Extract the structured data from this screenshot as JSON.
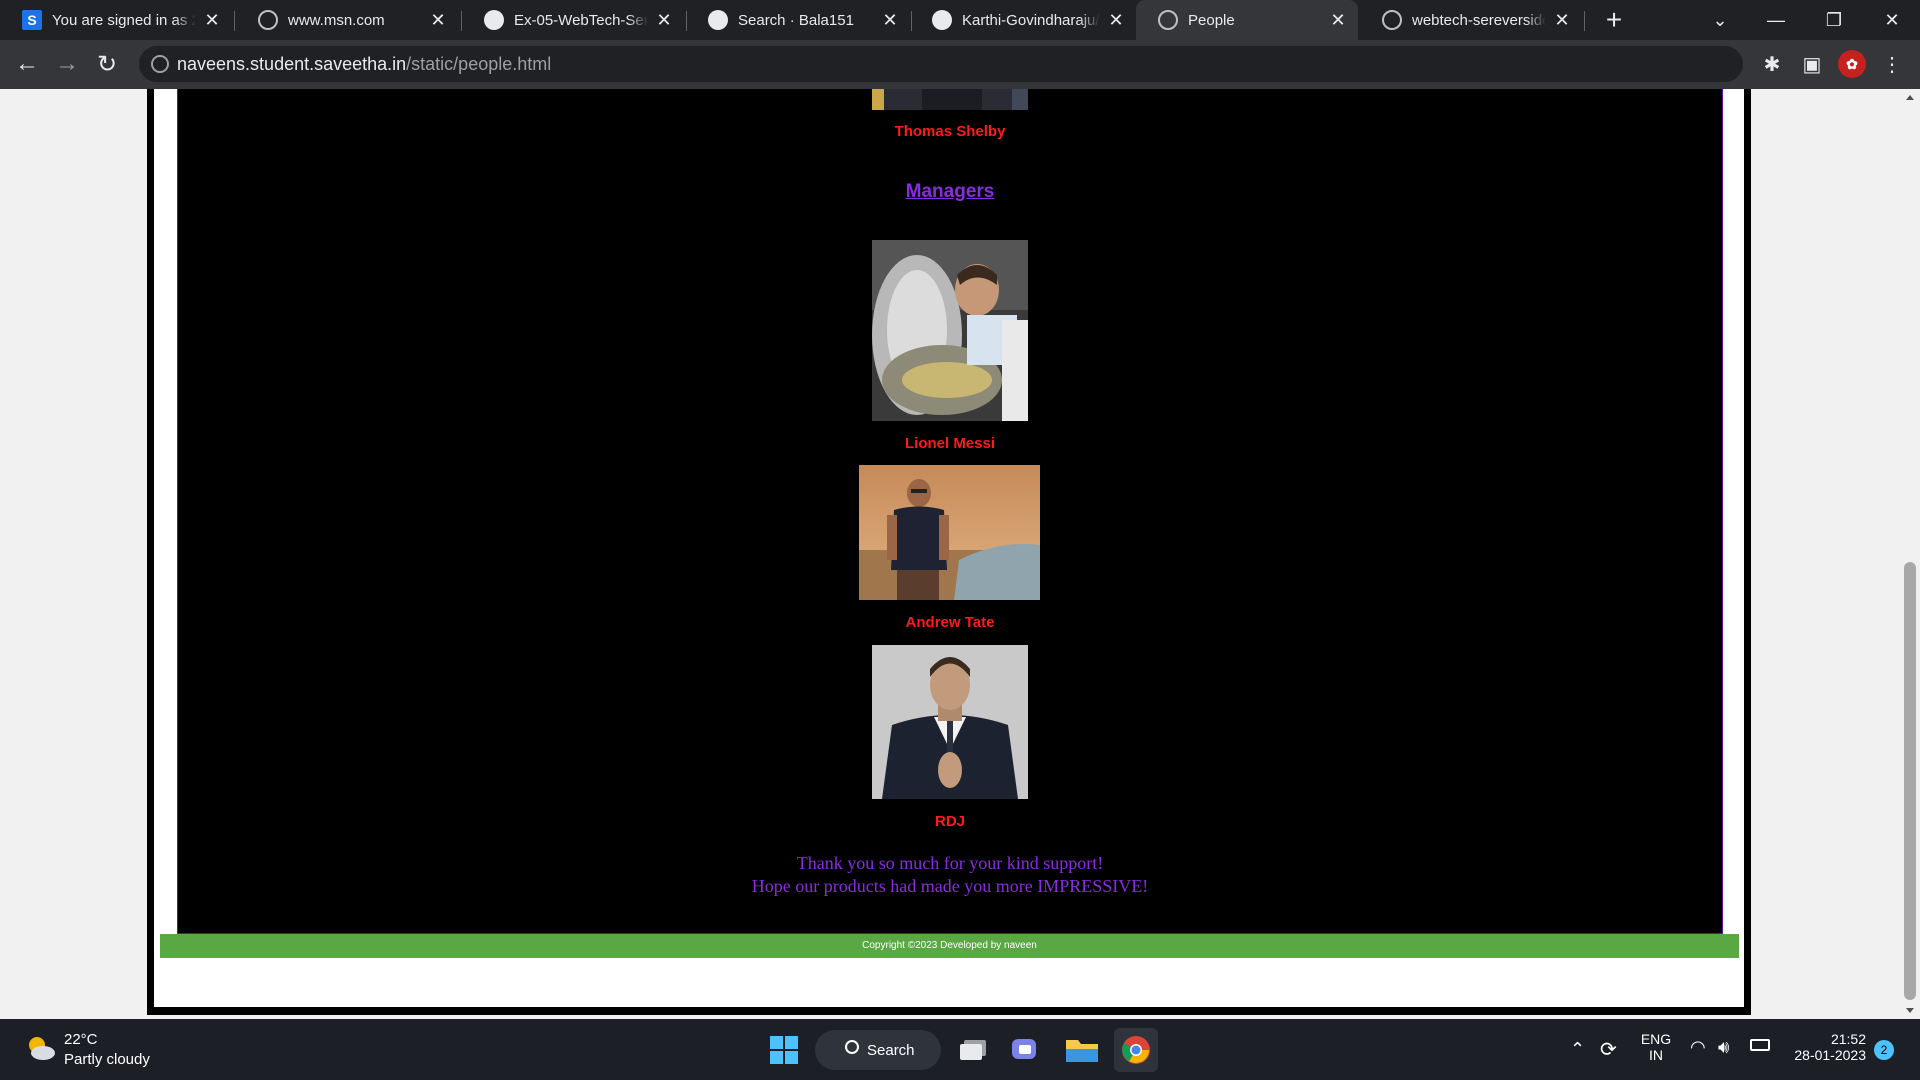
{
  "browser": {
    "tabs": [
      {
        "title": "You are signed in as 2",
        "favicon": "s-icon",
        "active": false
      },
      {
        "title": "www.msn.com",
        "favicon": "globe-icon",
        "active": false
      },
      {
        "title": "Ex-05-WebTech-Serve",
        "favicon": "github-icon",
        "active": false
      },
      {
        "title": "Search · Bala151",
        "favicon": "github-icon",
        "active": false
      },
      {
        "title": "Karthi-Govindharaju/E",
        "favicon": "github-icon",
        "active": false
      },
      {
        "title": "People",
        "favicon": "globe-icon",
        "active": true
      },
      {
        "title": "webtech-sereverside (",
        "favicon": "globe-icon",
        "active": false
      }
    ],
    "url_host": "naveens.student.saveetha.in",
    "url_path": "/static/people.html"
  },
  "page": {
    "top_person": "Thomas Shelby",
    "managers_heading": "Managers",
    "managers": [
      {
        "name": "Lionel Messi"
      },
      {
        "name": "Andrew Tate"
      },
      {
        "name": "RDJ"
      }
    ],
    "thanks_line1": "Thank you so much for your kind support!",
    "thanks_line2": "Hope our products had made you more IMPRESSIVE!",
    "footer": "Copyright ©2023 Developed by naveen"
  },
  "taskbar": {
    "temperature": "22°C",
    "weather": "Partly cloudy",
    "search_label": "Search",
    "language_top": "ENG",
    "language_bottom": "IN",
    "time": "21:52",
    "date": "28-01-2023",
    "notification_count": "2"
  },
  "colors": {
    "name_red": "#ff1a1a",
    "heading_purple": "#8a2be2",
    "footer_green": "#5aa844"
  }
}
